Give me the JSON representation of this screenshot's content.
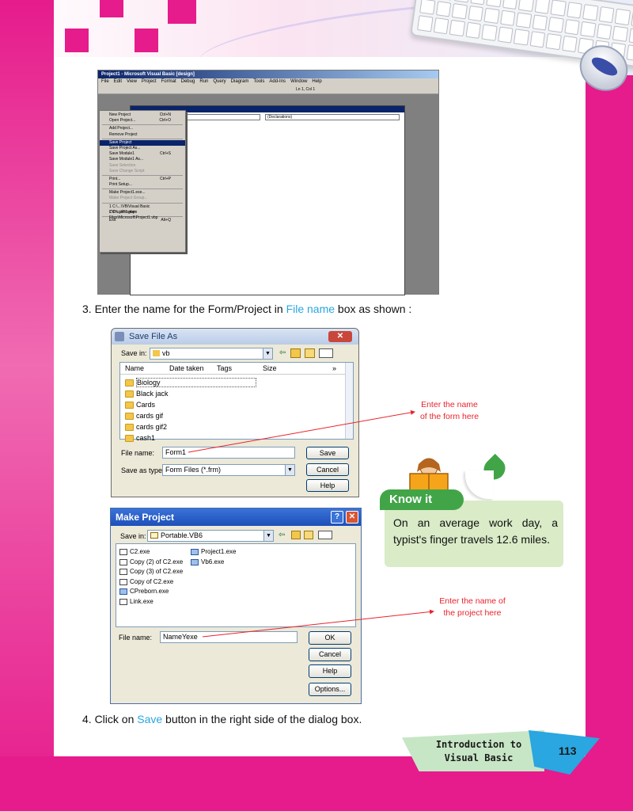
{
  "ide": {
    "title": "Project1 - Microsoft Visual Basic [design]",
    "menus": [
      "File",
      "Edit",
      "View",
      "Project",
      "Format",
      "Debug",
      "Run",
      "Query",
      "Diagram",
      "Tools",
      "Add-Ins",
      "Window",
      "Help"
    ],
    "position": "Ln 1, Col 1",
    "code_combo_left": "",
    "code_combo_right": "(Declarations)",
    "file_menu": [
      {
        "label": "New Project",
        "shortcut": "Ctrl+N",
        "state": "normal"
      },
      {
        "label": "Open Project...",
        "shortcut": "Ctrl+O",
        "state": "normal"
      },
      {
        "label": "Add Project...",
        "shortcut": "",
        "state": "normal"
      },
      {
        "label": "Remove Project",
        "shortcut": "",
        "state": "normal"
      },
      {
        "label": "Save Project",
        "shortcut": "",
        "state": "selected"
      },
      {
        "label": "Save Project As...",
        "shortcut": "",
        "state": "normal"
      },
      {
        "label": "Save Module1",
        "shortcut": "Ctrl+S",
        "state": "normal"
      },
      {
        "label": "Save Module1 As...",
        "shortcut": "",
        "state": "normal"
      },
      {
        "label": "Save Selection",
        "shortcut": "",
        "state": "gray"
      },
      {
        "label": "Save Change Script",
        "shortcut": "",
        "state": "gray"
      },
      {
        "label": "Print...",
        "shortcut": "Ctrl+P",
        "state": "normal"
      },
      {
        "label": "Print Setup...",
        "shortcut": "",
        "state": "normal"
      },
      {
        "label": "Make Project1.exe...",
        "shortcut": "",
        "state": "normal"
      },
      {
        "label": "Make Project Group...",
        "shortcut": "",
        "state": "gray"
      },
      {
        "label": "1 C:\\...\\VB\\Visual Basic C\\Project1.vbp",
        "shortcut": "",
        "state": "normal"
      },
      {
        "label": "2 C:\\...\\Program Files\\Microsoft\\Project1.vbp",
        "shortcut": "",
        "state": "normal"
      },
      {
        "label": "Exit",
        "shortcut": "Alt+Q",
        "state": "normal"
      }
    ]
  },
  "step3": {
    "prefix": "3.  Enter the name for the Form/Project in ",
    "highlight": "File name",
    "suffix": " box as shown :"
  },
  "save_dialog": {
    "title": "Save File As",
    "save_in_label": "Save in:",
    "save_in_value": "vb",
    "columns": [
      "Name",
      "Date taken",
      "Tags",
      "Size"
    ],
    "folders": [
      "Biology",
      "Black jack",
      "Cards",
      "cards gif",
      "cards gif2",
      "cash1"
    ],
    "file_name_label": "File name:",
    "file_name_value": "Form1",
    "save_type_label": "Save as type:",
    "save_type_value": "Form Files (*.frm)",
    "buttons": {
      "save": "Save",
      "cancel": "Cancel",
      "help": "Help"
    }
  },
  "callout_form": {
    "line1": "Enter  the  name",
    "line2": "of the form here"
  },
  "know_it": {
    "tab": "Know it",
    "text": "On an average work day, a typist's finger travels 12.6 miles."
  },
  "make_dialog": {
    "title": "Make Project",
    "help_glyph": "?",
    "close_glyph": "✕",
    "save_in_label": "Save in:",
    "save_in_value": "Portable.VB6",
    "files_left": [
      {
        "name": "C2.exe",
        "kind": "exe"
      },
      {
        "name": "Copy (2) of C2.exe",
        "kind": "exe"
      },
      {
        "name": "Copy (3) of C2.exe",
        "kind": "exe"
      },
      {
        "name": "Copy of C2.exe",
        "kind": "exe"
      },
      {
        "name": "CPreborn.exe",
        "kind": "app"
      },
      {
        "name": "Link.exe",
        "kind": "exe"
      }
    ],
    "files_right": [
      {
        "name": "Project1.exe",
        "kind": "app"
      },
      {
        "name": "Vb6.exe",
        "kind": "app"
      }
    ],
    "file_name_label": "File name:",
    "file_name_value": "NameYexe",
    "buttons": {
      "ok": "OK",
      "cancel": "Cancel",
      "help": "Help",
      "options": "Options..."
    }
  },
  "callout_project": {
    "line1": "Enter the name of",
    "line2": "the project here"
  },
  "step4": {
    "prefix": "4.  Click on ",
    "highlight": "Save",
    "suffix": " button in the right side of the dialog box."
  },
  "footer": {
    "chapter_line1": "Introduction to",
    "chapter_line2": "Visual Basic",
    "page_number": "113"
  },
  "colors": {
    "brand_pink": "#e61b8c",
    "highlight_blue": "#2aa6e0",
    "callout_red": "#e8232b",
    "knowit_green": "#41a548"
  }
}
